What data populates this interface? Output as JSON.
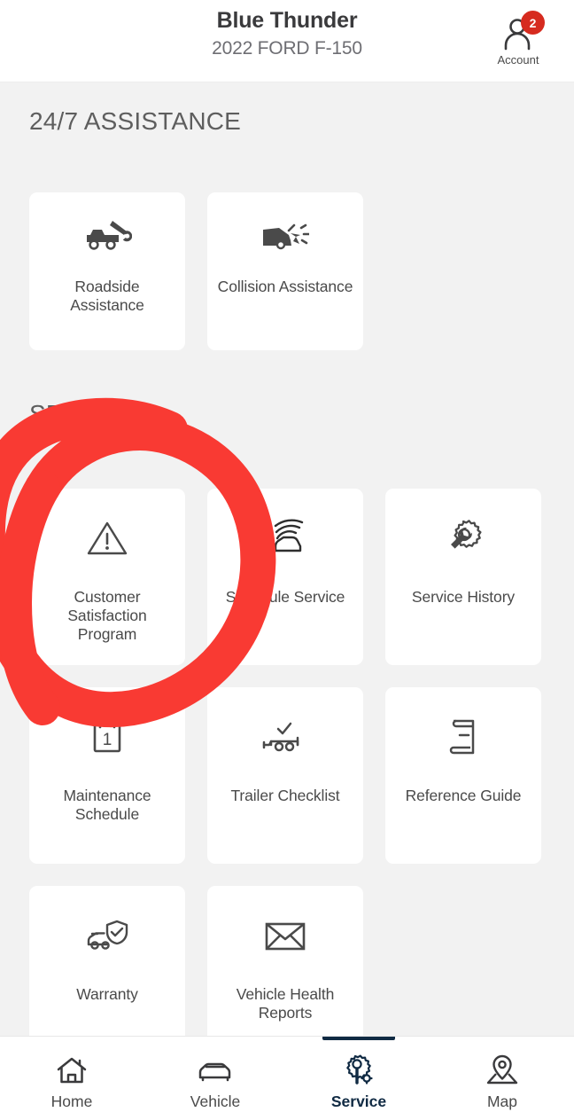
{
  "header": {
    "vehicle_name": "Blue Thunder",
    "vehicle_model": "2022 FORD F-150",
    "account_label": "Account",
    "account_badge_count": "2",
    "badge_color": "#D62B1F"
  },
  "sections": [
    {
      "id": "assistance",
      "title": "24/7 ASSISTANCE"
    },
    {
      "id": "service",
      "title": "SERVICE"
    }
  ],
  "assistance_cards": [
    {
      "label": "Roadside Assistance",
      "icon": "tow-truck-icon"
    },
    {
      "label": "Collision Assistance",
      "icon": "collision-car-icon"
    }
  ],
  "service_cards": [
    {
      "label": "Customer Satisfaction Program",
      "icon": "warning-triangle-icon"
    },
    {
      "label": "Schedule Service",
      "icon": "car-wave-icon"
    },
    {
      "label": "Service History",
      "icon": "gear-wrench-icon"
    },
    {
      "label": "Maintenance Schedule",
      "icon": "calendar-icon",
      "icon_text": "1"
    },
    {
      "label": "Trailer Checklist",
      "icon": "trailer-check-icon"
    },
    {
      "label": "Reference Guide",
      "icon": "book-icon"
    },
    {
      "label": "Warranty",
      "icon": "car-shield-icon"
    },
    {
      "label": "Vehicle Health Reports",
      "icon": "envelope-icon"
    }
  ],
  "annotation": {
    "type": "hand-drawn-circle",
    "color": "#F93A33",
    "targets": "Customer Satisfaction Program"
  },
  "bottom_nav": {
    "active": "Service",
    "active_color": "#102A43",
    "items": [
      {
        "label": "Home",
        "icon": "home-icon"
      },
      {
        "label": "Vehicle",
        "icon": "car-icon"
      },
      {
        "label": "Service",
        "icon": "wrench-gear-icon"
      },
      {
        "label": "Map",
        "icon": "map-pin-icon"
      }
    ]
  }
}
